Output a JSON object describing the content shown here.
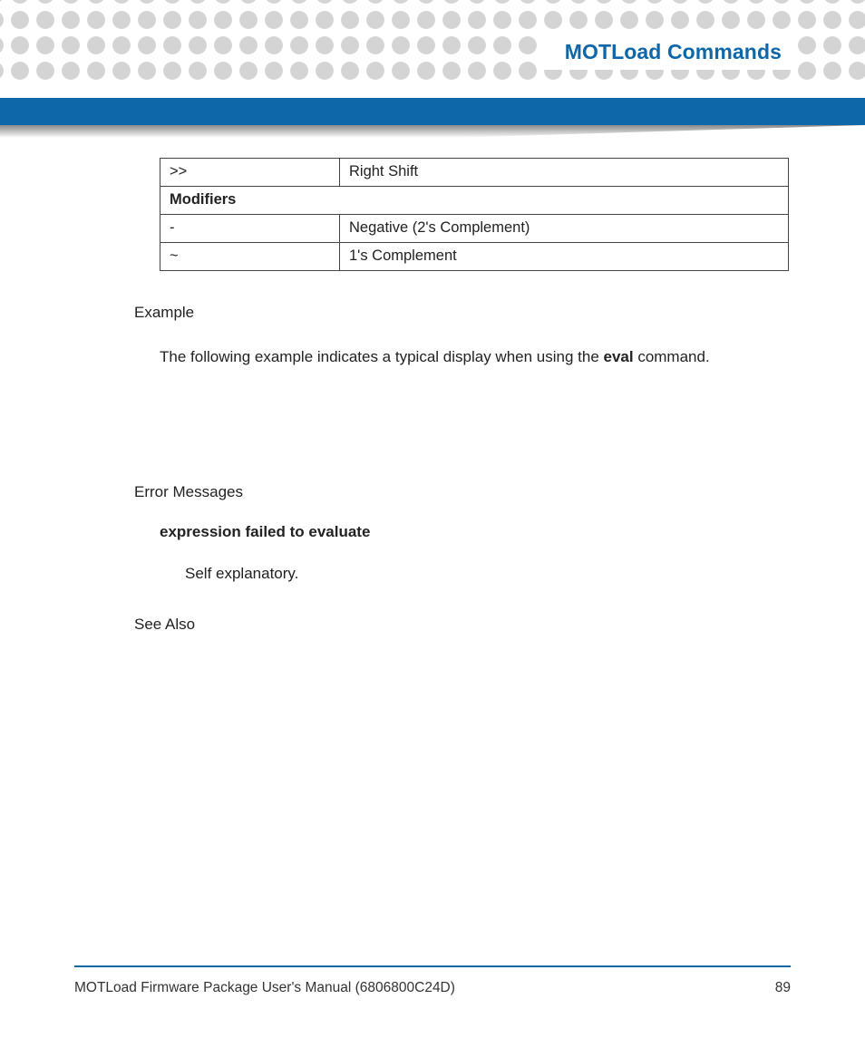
{
  "header": {
    "title": "MOTLoad Commands"
  },
  "table": {
    "rows": [
      {
        "c1": ">>",
        "c2": "Right Shift"
      }
    ],
    "section": "Modifiers",
    "mods": [
      {
        "c1": "-",
        "c2": "Negative (2's Complement)"
      },
      {
        "c1": "~",
        "c2": "1's Complement"
      }
    ]
  },
  "example": {
    "label": "Example",
    "text_pre": "The following example indicates a typical display when using the ",
    "cmd": "eval",
    "text_post": " command."
  },
  "errors": {
    "label": "Error Messages",
    "msg": "expression failed to evaluate",
    "body": "Self explanatory."
  },
  "seealso": {
    "label": "See Also"
  },
  "footer": {
    "left": "MOTLoad Firmware Package User's Manual (6806800C24D)",
    "page": "89"
  }
}
